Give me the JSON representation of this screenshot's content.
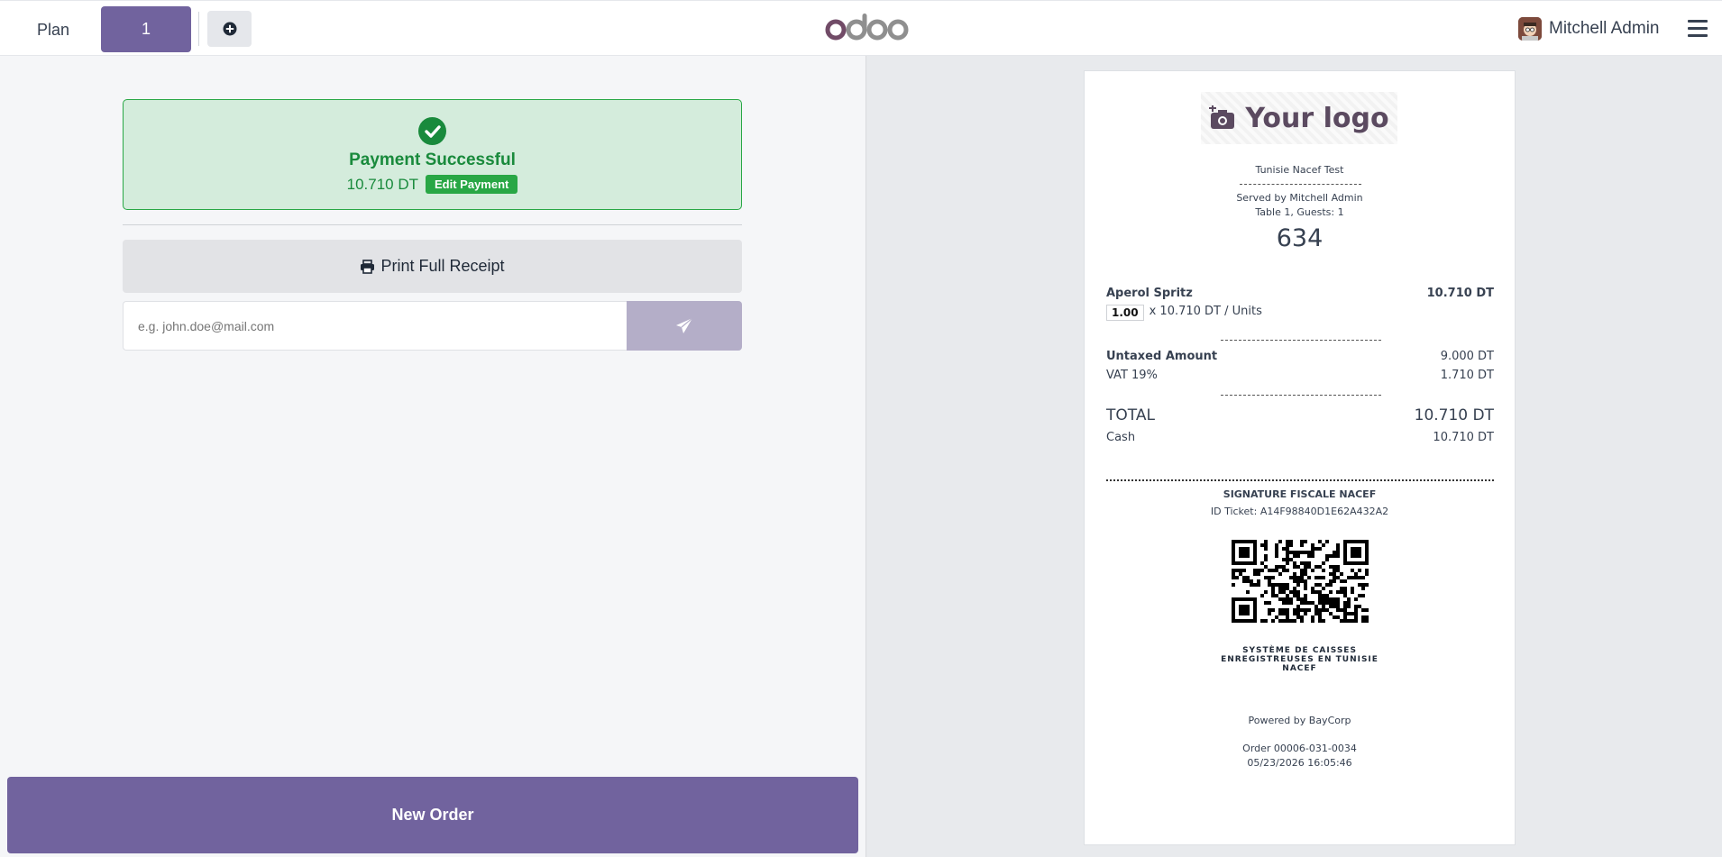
{
  "navbar": {
    "plan_label": "Plan",
    "table_label": "1",
    "logo_text": "odoo",
    "user_name": "Mitchell Admin"
  },
  "payment": {
    "title": "Payment Successful",
    "amount": "10.710 DT",
    "edit_label": "Edit Payment",
    "print_label": "Print Full Receipt",
    "email_placeholder": "e.g. john.doe@mail.com",
    "new_order_label": "New Order"
  },
  "receipt": {
    "logo_text": "Your logo",
    "company": "Tunisie Nacef Test",
    "served_by": "Served by Mitchell Admin",
    "table_guests": "Table 1, Guests: 1",
    "order_number": "634",
    "lines": [
      {
        "product": "Aperol Spritz",
        "price": "10.710 DT",
        "qty": "1.00",
        "unit_detail": "x 10.710 DT / Units"
      }
    ],
    "untaxed_label": "Untaxed Amount",
    "untaxed_value": "9.000 DT",
    "vat_label": "VAT 19%",
    "vat_value": "1.710 DT",
    "total_label": "TOTAL",
    "total_value": "10.710 DT",
    "cash_label": "Cash",
    "cash_value": "10.710 DT",
    "signature_title": "SIGNATURE FISCALE NACEF",
    "ticket_id": "ID Ticket: A14F98840D1E62A432A2",
    "system_line1": "SYSTÈME DE CAISSES",
    "system_line2": "ENREGISTREUSES EN TUNISIE",
    "system_line3": "NACEF",
    "powered_by": "Powered by BayCorp",
    "order_ref": "Order 00006-031-0034",
    "datetime": "05/23/2026 16:05:46"
  },
  "colors": {
    "brand": "#71639e",
    "success": "#28a745",
    "success_bg": "#d4ecdc"
  }
}
